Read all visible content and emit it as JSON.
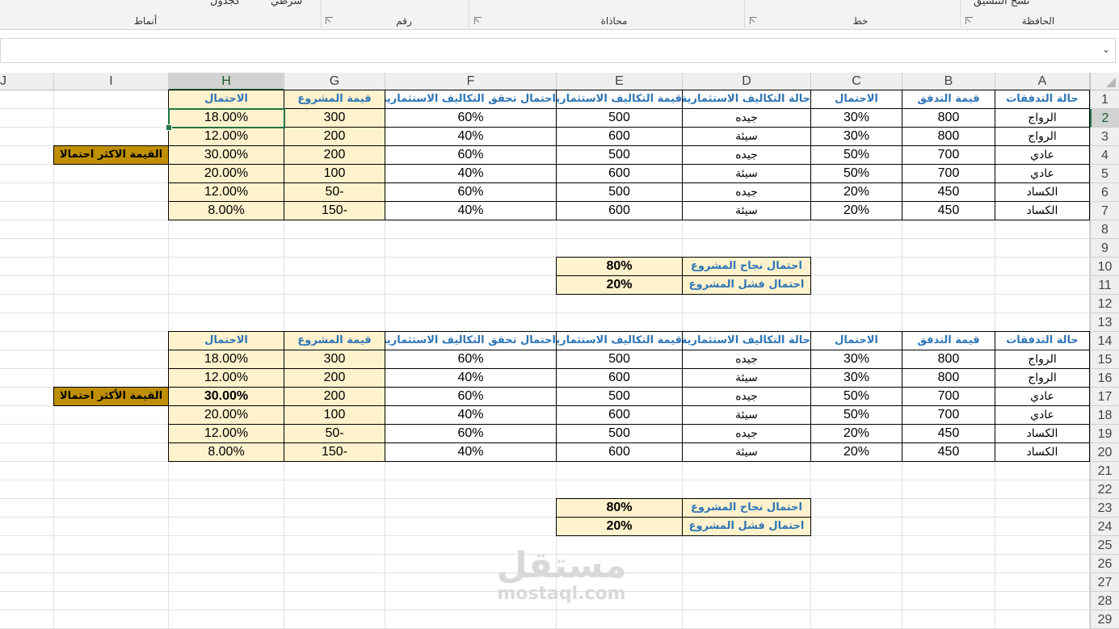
{
  "ribbon": {
    "groups": [
      "أنماط",
      "رقم",
      "محاذاة",
      "خط",
      "الحافظة"
    ],
    "fragments": [
      "شرطي",
      "كجدول",
      "نسخ التنسيق"
    ]
  },
  "formula_bar": {
    "value": ""
  },
  "columns": [
    "J",
    "I",
    "H",
    "G",
    "F",
    "E",
    "D",
    "C",
    "B",
    "A"
  ],
  "rows": [
    "1",
    "2",
    "3",
    "4",
    "5",
    "6",
    "7",
    "8",
    "9",
    "10",
    "11",
    "12",
    "13",
    "14",
    "15",
    "16",
    "17",
    "18",
    "19",
    "20",
    "21",
    "22",
    "23",
    "24",
    "25",
    "26",
    "27",
    "28",
    "29"
  ],
  "selected_column": "H",
  "selected_row": "2",
  "table_headers": {
    "A": "حالة التدفقات",
    "B": "قيمة التدفق",
    "C": "الاحتمال",
    "D": "حالة التكاليف الاستثمارية",
    "E": "قيمة التكاليف الاستثمارية",
    "F": "احتمال تحقق التكاليف الاستثمارية",
    "G": "قيمة المشروع",
    "H": "الاحتمال"
  },
  "table1": [
    {
      "A": "الرواج",
      "B": "800",
      "C": "30%",
      "D": "جيده",
      "E": "500",
      "F": "60%",
      "G": "300",
      "H": "18.00%"
    },
    {
      "A": "الرواج",
      "B": "800",
      "C": "30%",
      "D": "سيئة",
      "E": "600",
      "F": "40%",
      "G": "200",
      "H": "12.00%"
    },
    {
      "A": "عادي",
      "B": "700",
      "C": "50%",
      "D": "جيده",
      "E": "500",
      "F": "60%",
      "G": "200",
      "H": "30.00%"
    },
    {
      "A": "عادي",
      "B": "700",
      "C": "50%",
      "D": "سيئة",
      "E": "600",
      "F": "40%",
      "G": "100",
      "H": "20.00%"
    },
    {
      "A": "الكساد",
      "B": "450",
      "C": "20%",
      "D": "جيده",
      "E": "500",
      "F": "60%",
      "G": "-50",
      "H": "12.00%"
    },
    {
      "A": "الكساد",
      "B": "450",
      "C": "20%",
      "D": "سيئة",
      "E": "600",
      "F": "40%",
      "G": "-150",
      "H": "8.00%"
    }
  ],
  "table2": [
    {
      "A": "الرواج",
      "B": "800",
      "C": "30%",
      "D": "جيده",
      "E": "500",
      "F": "60%",
      "G": "300",
      "H": "18.00%"
    },
    {
      "A": "الرواج",
      "B": "800",
      "C": "30%",
      "D": "سيئة",
      "E": "600",
      "F": "40%",
      "G": "200",
      "H": "12.00%"
    },
    {
      "A": "عادي",
      "B": "700",
      "C": "50%",
      "D": "جيده",
      "E": "500",
      "F": "60%",
      "G": "200",
      "H": "30.00%"
    },
    {
      "A": "عادي",
      "B": "700",
      "C": "50%",
      "D": "سيئة",
      "E": "600",
      "F": "40%",
      "G": "100",
      "H": "20.00%"
    },
    {
      "A": "الكساد",
      "B": "450",
      "C": "20%",
      "D": "جيده",
      "E": "500",
      "F": "60%",
      "G": "-50",
      "H": "12.00%"
    },
    {
      "A": "الكساد",
      "B": "450",
      "C": "20%",
      "D": "سيئة",
      "E": "600",
      "F": "40%",
      "G": "-150",
      "H": "8.00%"
    }
  ],
  "tags": {
    "row4": "القيمة الاكثر احتمالا",
    "row17": "القيمة الأكثر احتمالا"
  },
  "summary1": {
    "success_label": "احتمال نجاح المشروع",
    "success_value": "80%",
    "failure_label": "احتمال فشل المشروع",
    "failure_value": "20%"
  },
  "summary2": {
    "success_label": "احتمال نجاح المشروع",
    "success_value": "80%",
    "failure_label": "احتمال فشل المشروع",
    "failure_value": "20%"
  },
  "watermark": {
    "arabic": "مستقل",
    "latin": "mostaql.com"
  },
  "colors": {
    "header_text": "#2e75b6",
    "highlight_fill": "#fff2cc",
    "tag_fill": "#bf8f00",
    "selection": "#217346"
  }
}
